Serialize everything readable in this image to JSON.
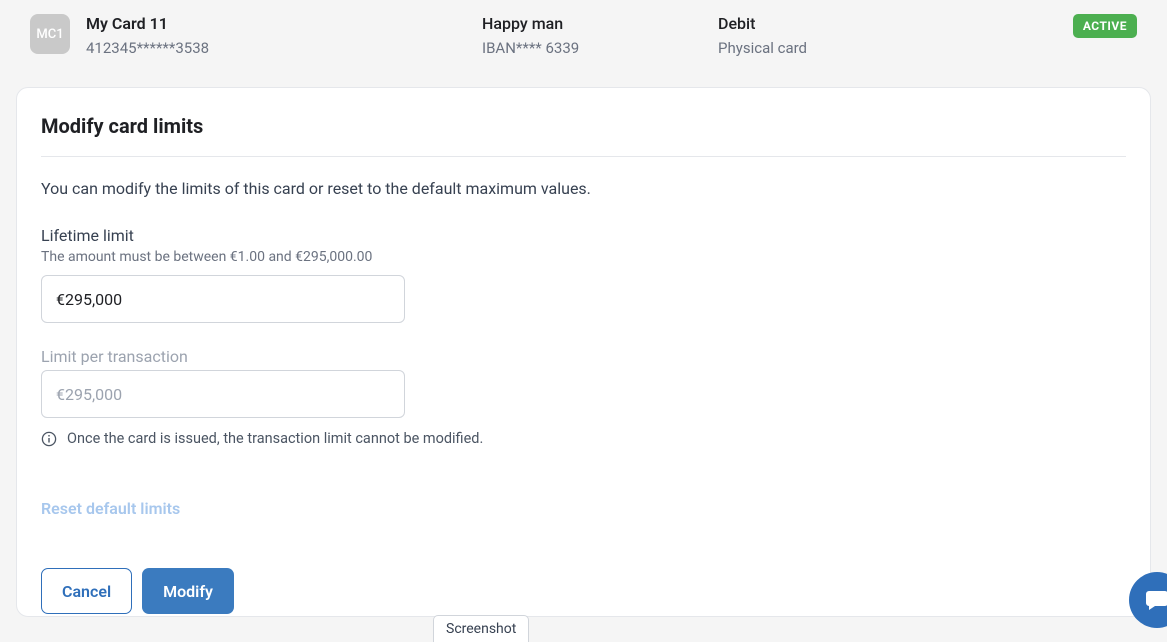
{
  "header": {
    "avatar_initials": "MC1",
    "card": {
      "name": "My Card 11",
      "number_masked": "412345******3538"
    },
    "owner": {
      "name": "Happy man",
      "iban_masked": "IBAN**** 6339"
    },
    "type": {
      "kind": "Debit",
      "medium": "Physical card"
    },
    "status_badge": "ACTIVE"
  },
  "panel": {
    "title": "Modify card limits",
    "description": "You can modify the limits of this card or reset to the default maximum values.",
    "lifetime": {
      "label": "Lifetime limit",
      "hint": "The amount must be between €1.00 and €295,000.00",
      "value": "€295,000"
    },
    "per_transaction": {
      "label": "Limit per transaction",
      "value": "€295,000",
      "info": "Once the card is issued, the transaction limit cannot be modified."
    },
    "reset_link": "Reset default limits",
    "actions": {
      "cancel": "Cancel",
      "modify": "Modify"
    }
  },
  "misc": {
    "screenshot_tip": "Screenshot"
  }
}
